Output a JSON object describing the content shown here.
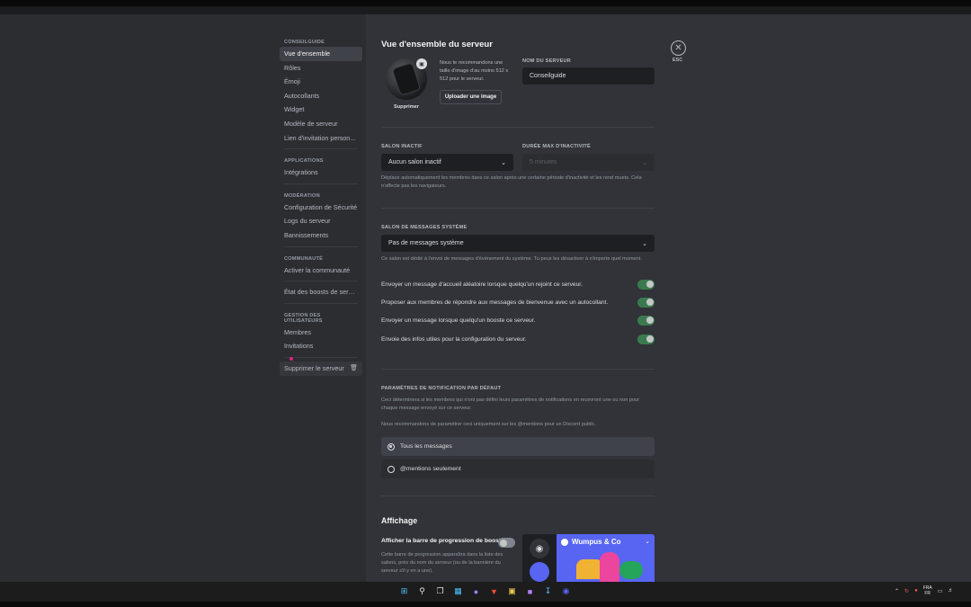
{
  "nav": {
    "sections": [
      {
        "title": "CONSEILGUIDE",
        "items": [
          "Vue d'ensemble",
          "Rôles",
          "Émoji",
          "Autocollants",
          "Widget",
          "Modèle de serveur",
          "Lien d'invitation person..."
        ]
      },
      {
        "title": "APPLICATIONS",
        "items": [
          "Intégrations"
        ]
      },
      {
        "title": "MODÉRATION",
        "items": [
          "Configuration de Sécurité",
          "Logs du serveur",
          "Bannissements"
        ]
      },
      {
        "title": "COMMUNAUTÉ",
        "items": [
          "Activer la communauté"
        ]
      },
      {
        "title": "",
        "items": [
          "État des boosts de serveur"
        ]
      },
      {
        "title": "GESTION DES UTILISATEURS",
        "items": [
          "Membres",
          "Invitations"
        ]
      }
    ],
    "delete_label": "Supprimer le serveur"
  },
  "page": {
    "title": "Vue d'ensemble du serveur",
    "esc_label": "ESC"
  },
  "overview": {
    "remove_label": "Supprimer",
    "recommend_text": "Nous te recommandons une taille d'image d'au moins 512 x 512 pour le serveur.",
    "upload_label": "Uploader une image",
    "server_name_label": "NOM DU SERVEUR",
    "server_name_value": "Conseilguide"
  },
  "inactive": {
    "channel_label": "SALON INACTIF",
    "channel_value": "Aucun salon inactif",
    "timeout_label": "DURÉE MAX D'INACTIVITÉ",
    "timeout_value": "5 minutes",
    "description": "Déplace automatiquement les membres dans ce salon après une certaine période d'inactivité et les rend muets. Cela n'affecte pas les navigateurs."
  },
  "system": {
    "label": "SALON DE MESSAGES SYSTÈME",
    "value": "Pas de messages système",
    "description": "Ce salon est dédié à l'envoi de messages d'événement du système. Tu peux les désactiver à n'importe quel moment.",
    "toggles": [
      {
        "label": "Envoyer un message d'accueil aléatoire lorsque quelqu'un rejoint ce serveur.",
        "on": true
      },
      {
        "label": "Proposer aux membres de répondre aux messages de bienvenue avec un autocollant.",
        "on": true
      },
      {
        "label": "Envoyer un message lorsque quelqu'un booste ce serveur.",
        "on": true
      },
      {
        "label": "Envoie des infos utiles pour la configuration du serveur.",
        "on": true
      }
    ]
  },
  "notifications": {
    "label": "PARAMÈTRES DE NOTIFICATION PAR DÉFAUT",
    "description": "Ceci déterminera si les membres qui n'ont pas défini leurs paramètres de notifications en recevront une ou non pour chaque message envoyé sur ce serveur.",
    "recommend": "Nous recommandons de paramétrer ceci uniquement sur les @mentions pour un Discord public.",
    "options": [
      {
        "label": "Tous les messages",
        "selected": true
      },
      {
        "label": "@mentions seulement",
        "selected": false
      }
    ]
  },
  "display": {
    "title": "Affichage",
    "boost_bar_label": "Afficher la barre de progression de boost",
    "boost_bar_on": false,
    "boost_bar_desc": "Cette barre de progression apparaîtra dans la liste des salons, près du nom du serveur (ou de la bannière du serveur s'il y en a une).",
    "preview_name": "Wumpus & Co"
  },
  "taskbar": {
    "lang_top": "FRA",
    "lang_bottom": "FR"
  },
  "colors": {
    "sidebar": "#2b2d31",
    "main": "#313338",
    "toggle_on": "#3b7a4f",
    "blurple": "#5865f2"
  }
}
